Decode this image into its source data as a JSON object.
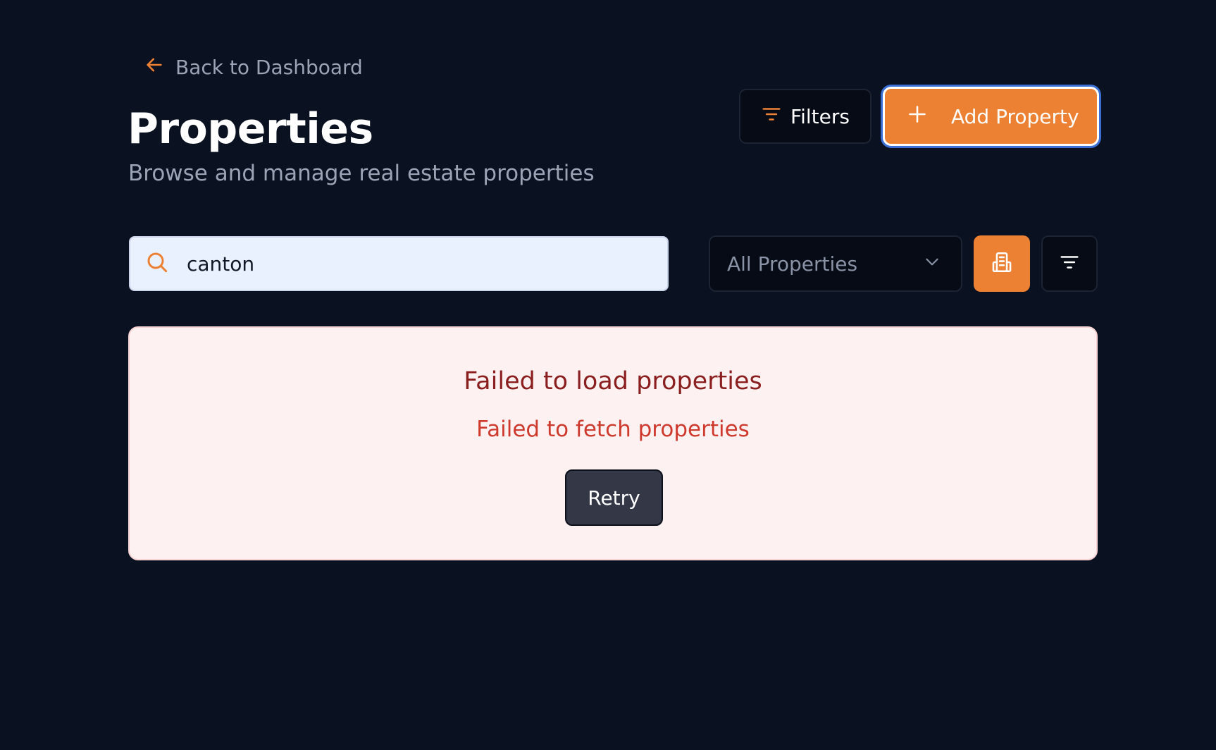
{
  "nav": {
    "back_label": "Back to Dashboard"
  },
  "header": {
    "title": "Properties",
    "subtitle": "Browse and manage real estate properties",
    "filters_label": "Filters",
    "add_label": "Add Property"
  },
  "toolbar": {
    "search_value": "canton",
    "property_type_selected": "All Properties"
  },
  "error": {
    "title": "Failed to load properties",
    "message": "Failed to fetch properties",
    "retry_label": "Retry"
  },
  "icons": {
    "back": "arrow-left-icon",
    "filters": "filter-lines-icon",
    "add": "plus-icon",
    "search": "search-icon",
    "select": "chevron-down-icon",
    "grid_view": "building-icon",
    "sort": "sort-lines-icon"
  },
  "colors": {
    "background": "#0a1120",
    "accent": "#ed8133",
    "error_bg": "#fdf1f1",
    "error_title": "#8b1f1f",
    "error_text": "#cf3a2e",
    "focus_ring": "#3b6fd6"
  }
}
